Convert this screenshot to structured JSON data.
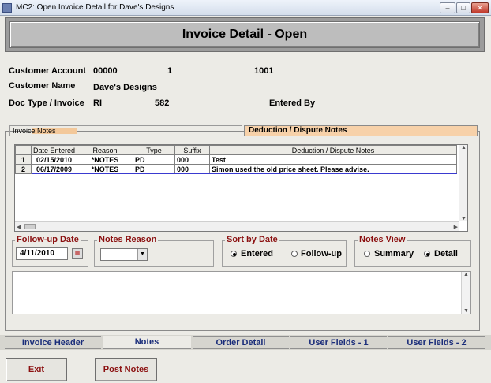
{
  "window": {
    "title": "MC2: Open Invoice Detail for Dave's Designs",
    "minimize_glyph": "–",
    "maximize_glyph": "□",
    "close_glyph": "✕"
  },
  "header": {
    "title": "Invoice Detail - Open"
  },
  "info": {
    "customer_account_label": "Customer Account",
    "customer_account_value": "00000",
    "customer_account_num2": "1",
    "customer_account_num3": "1001",
    "customer_name_label": "Customer Name",
    "customer_name_value": "Dave's Designs",
    "doc_type_label": "Doc Type / Invoice",
    "doc_type_value": "RI",
    "invoice_number": "582",
    "entered_by_label": "Entered By"
  },
  "subtabs": {
    "left_label": "Invoice Notes",
    "right_label": "Deduction / Dispute Notes"
  },
  "grid": {
    "columns": [
      "Date Entered",
      "Reason",
      "Type",
      "Suffix",
      "Deduction / Dispute Notes"
    ],
    "rows": [
      {
        "num": "1",
        "date": "02/15/2010",
        "reason": "*NOTES",
        "type": "PD",
        "suffix": "000",
        "note": "Test"
      },
      {
        "num": "2",
        "date": "06/17/2009",
        "reason": "*NOTES",
        "type": "PD",
        "suffix": "000",
        "note": "Simon used the old price sheet.  Please advise."
      }
    ]
  },
  "followup": {
    "title": "Follow-up Date",
    "value": "4/11/2010",
    "cal_glyph": "▦"
  },
  "notes_reason": {
    "title": "Notes Reason",
    "value": ""
  },
  "sort_by": {
    "title": "Sort by Date",
    "options": [
      "Entered",
      "Follow-up"
    ],
    "selected": "Entered"
  },
  "notes_view": {
    "title": "Notes View",
    "options": [
      "Summary",
      "Detail"
    ],
    "selected": "Detail"
  },
  "bottom_tabs": [
    "Invoice Header",
    "Notes",
    "Order Detail",
    "User Fields - 1",
    "User Fields - 2"
  ],
  "active_tab": "Notes",
  "buttons": {
    "exit": "Exit",
    "post_notes": "Post Notes"
  },
  "colors": {
    "group_title": "#8b1010",
    "tab_text": "#1a2d7a",
    "notes_tab_bg": "#f7d1a9"
  }
}
